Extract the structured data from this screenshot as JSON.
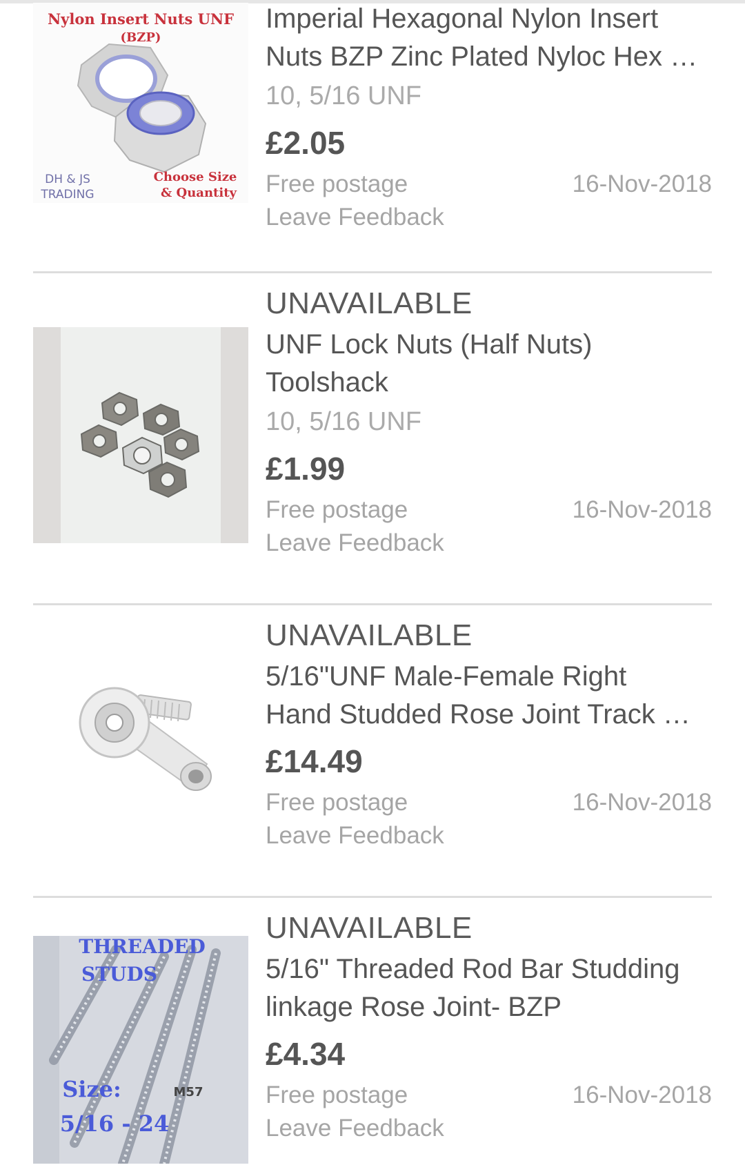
{
  "items": [
    {
      "status": "",
      "title_line1": "Imperial Hexagonal Nylon Insert",
      "title_line2": "Nuts BZP Zinc Plated Nyloc Hex …",
      "variant": "10, 5/16 UNF",
      "price": "£2.05",
      "postage": "Free postage",
      "date": "16-Nov-2018",
      "feedback": "Leave Feedback",
      "image_text": {
        "top": "Nylon Insert Nuts UNF",
        "sub": "(BZP)",
        "brand_line1": "DH & JS",
        "brand_line2": "TRADING",
        "choose_line1": "Choose Size",
        "choose_line2": "& Quantity"
      }
    },
    {
      "status": "UNAVAILABLE",
      "title_line1": "UNF Lock Nuts (Half Nuts)",
      "title_line2": "Toolshack",
      "variant": "10, 5/16 UNF",
      "price": "£1.99",
      "postage": "Free postage",
      "date": "16-Nov-2018",
      "feedback": "Leave Feedback"
    },
    {
      "status": "UNAVAILABLE",
      "title_line1": "5/16\"UNF Male-Female Right",
      "title_line2": "Hand Studded Rose Joint Track …",
      "variant": "",
      "price": "£14.49",
      "postage": "Free postage",
      "date": "16-Nov-2018",
      "feedback": "Leave Feedback"
    },
    {
      "status": "UNAVAILABLE",
      "title_line1": "5/16\" Threaded Rod Bar Studding",
      "title_line2": "linkage Rose Joint- BZP",
      "variant": "",
      "price": "£4.34",
      "postage": "Free postage",
      "date": "16-Nov-2018",
      "feedback": "Leave Feedback",
      "image_text": {
        "top_line1": "THREADED",
        "top_line2": "STUDS",
        "code": "M57",
        "size_line1": "Size:",
        "size_line2": "5/16 - 24"
      }
    }
  ],
  "colors": {
    "text_primary": "#555555",
    "text_secondary": "#a5a5a5",
    "divider": "#dddddd",
    "brand_red": "#c8323c",
    "brand_blue": "#4a5bd8"
  }
}
